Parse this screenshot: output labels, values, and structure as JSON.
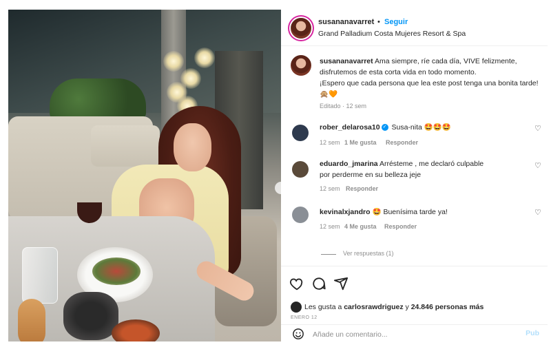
{
  "post": {
    "username": "susananavarret",
    "separator": "•",
    "follow_label": "Seguir",
    "location": "Grand Palladium Costa Mujeres Resort & Spa"
  },
  "caption": {
    "username": "susananavarret",
    "text": " Ama siempre, ríe cada día, VIVE felizmente, disfrutemos de esta corta vida en todo momento.",
    "text2": "¡Espero que cada persona que lea este post tenga una bonita tarde! 🙊🧡",
    "meta": "Editado · 12 sem"
  },
  "comments": [
    {
      "username": "rober_delarosa10",
      "verified": true,
      "text": " Susa-nita 🤩🤩🤩",
      "time": "12 sem",
      "likes": "1 Me gusta",
      "reply": "Responder",
      "avatar_color": "#2e3a4e"
    },
    {
      "username": "eduardo_jmarina",
      "verified": false,
      "text": " Arrésteme , me declaró culpable por perderme en su belleza jeje",
      "time": "12 sem",
      "likes": "",
      "reply": "Responder",
      "avatar_color": "#5a4a3a"
    },
    {
      "username": "kevinalxjandro",
      "verified": false,
      "text": " 🤩 Buenísima tarde ya!",
      "time": "12 sem",
      "likes": "4 Me gusta",
      "reply": "Responder",
      "avatar_color": "#8a8f96"
    }
  ],
  "replies_label": "Ver respuestas (1)",
  "likes": {
    "prefix": "Les gusta a ",
    "user": "carlosrawdriguez",
    "middle": " y ",
    "count": "24.846 personas más"
  },
  "date": "ENERO 12",
  "comment_box": {
    "placeholder": "Añade un comentario...",
    "post_label": "Pub"
  },
  "icons": [
    "heart-icon",
    "comment-icon",
    "share-icon",
    "emoji-icon"
  ]
}
